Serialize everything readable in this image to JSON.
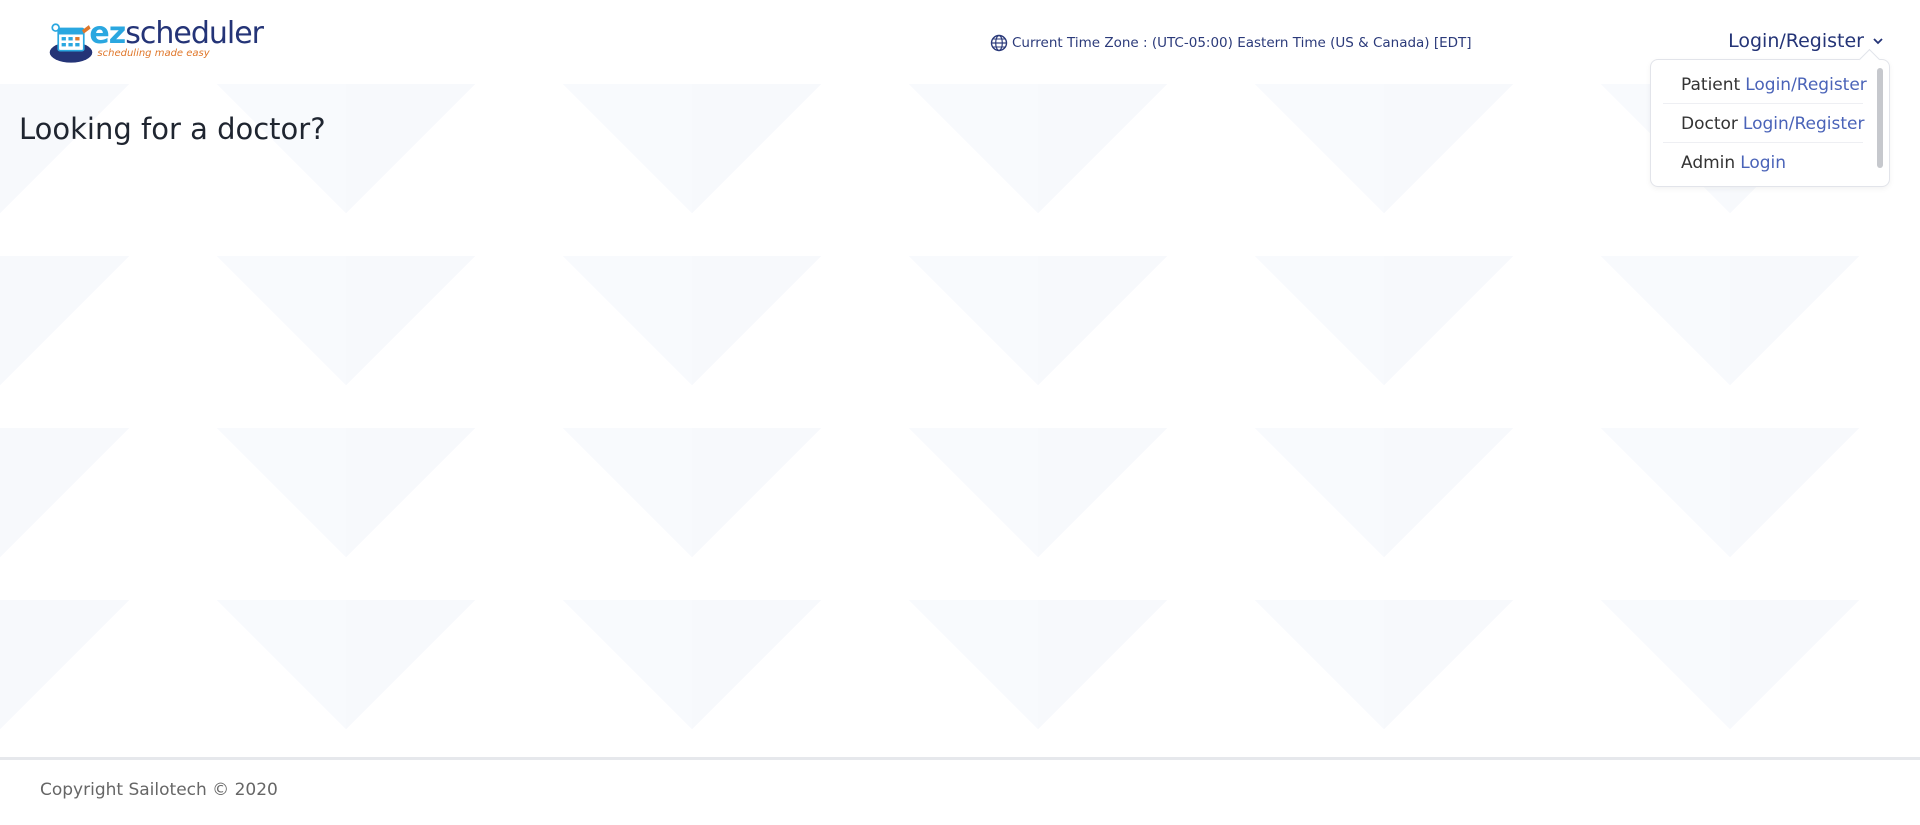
{
  "brand": {
    "name_prefix": "ez",
    "name_rest": "scheduler",
    "tagline": "scheduling made easy"
  },
  "header": {
    "timezone_text": "Current Time Zone : (UTC-05:00) Eastern Time (US & Canada) [EDT]",
    "login_label": "Login/Register"
  },
  "dropdown": {
    "items": [
      {
        "role": "Patient",
        "action": "Login/Register"
      },
      {
        "role": "Doctor",
        "action": "Login/Register"
      },
      {
        "role": "Admin",
        "action": "Login"
      }
    ]
  },
  "main": {
    "heading": "Looking for a doctor?"
  },
  "footer": {
    "copyright": "Copyright Sailotech © 2020"
  },
  "colors": {
    "brand_navy": "#243477",
    "brand_cyan": "#2aa7e0",
    "brand_orange": "#e0772a",
    "link": "#4a63b8"
  },
  "icons": {
    "globe": "globe-icon",
    "chevron": "chevron-down-icon"
  }
}
